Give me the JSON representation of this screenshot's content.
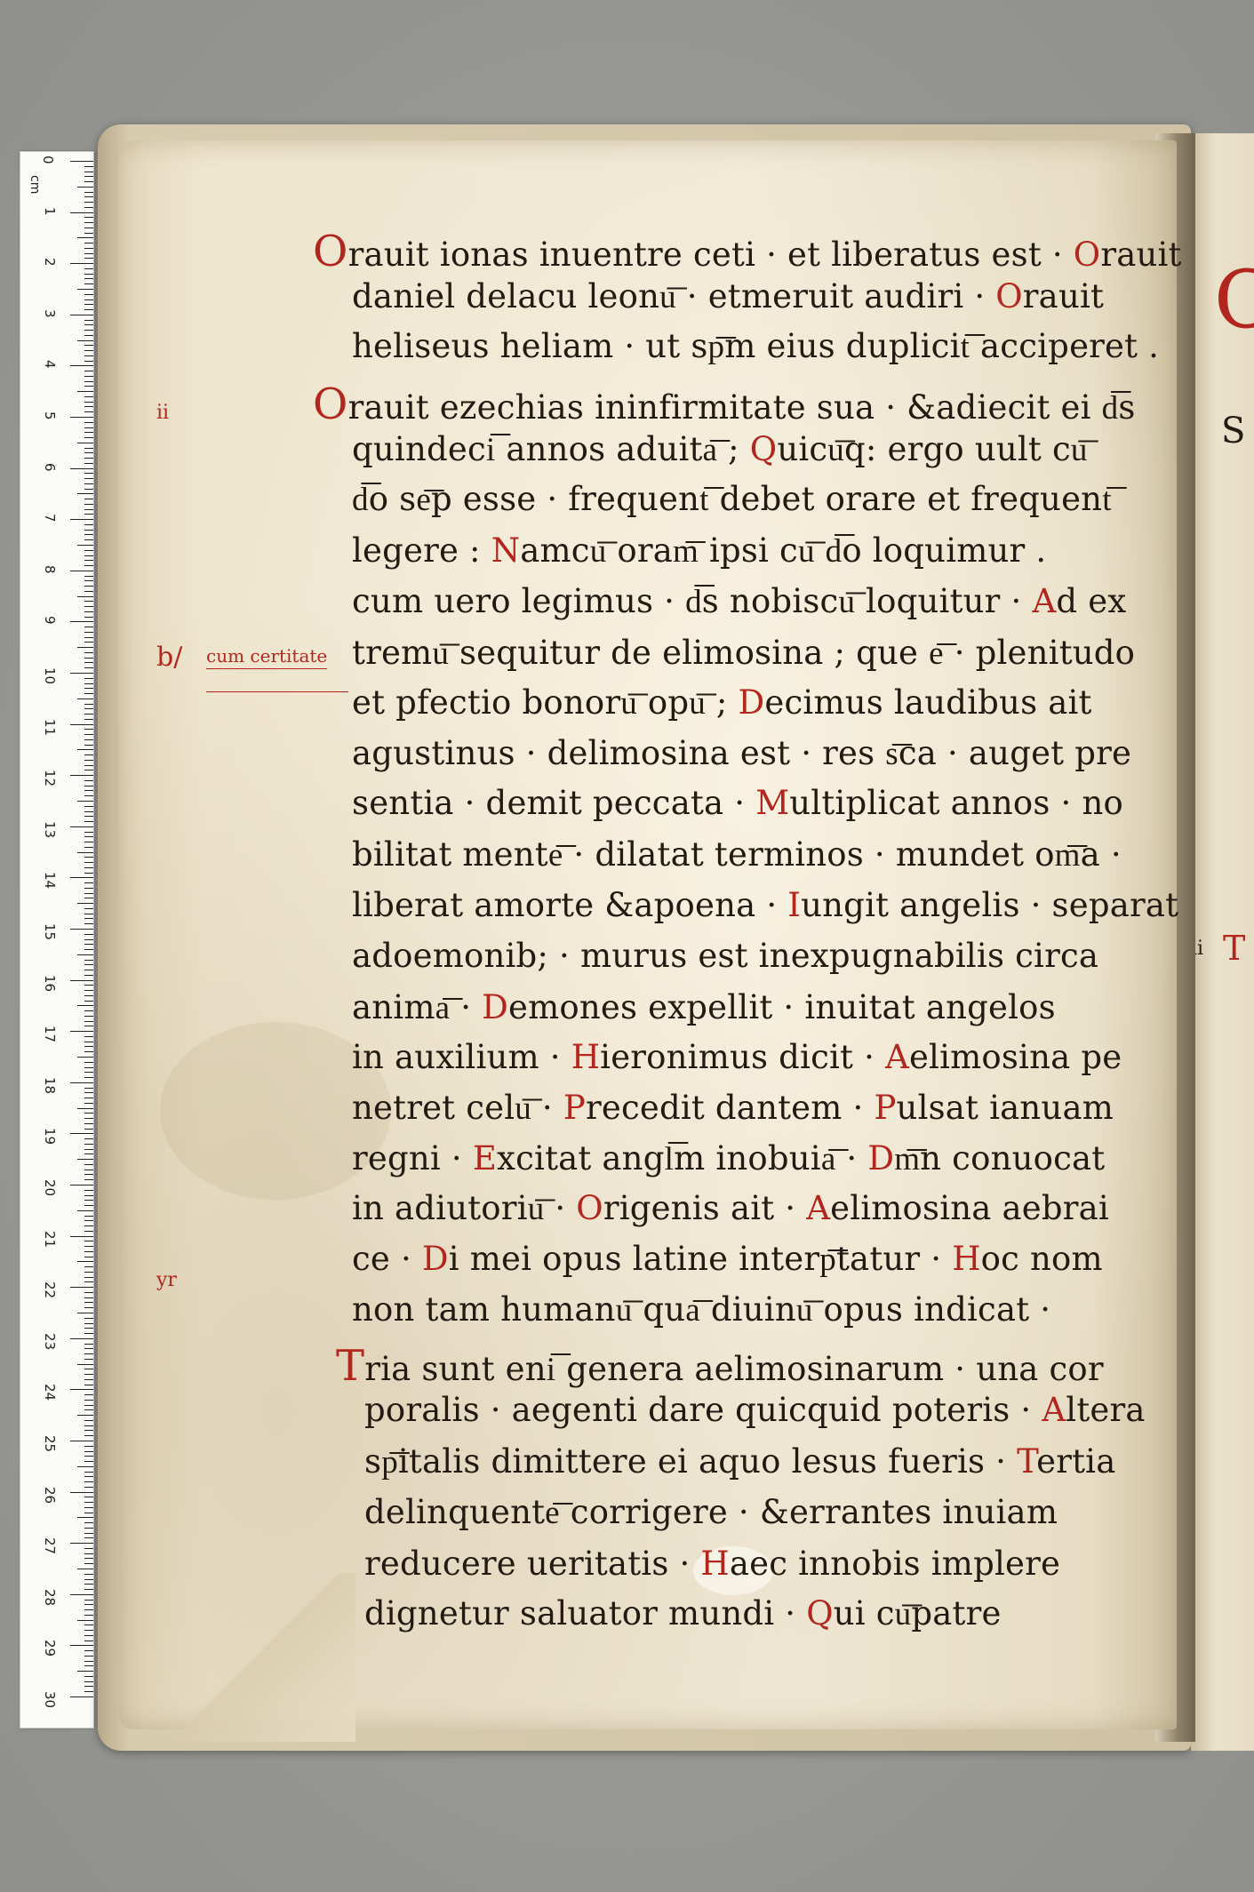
{
  "ruler": {
    "unit": "cm",
    "labels": [
      "0",
      "1",
      "2",
      "3",
      "4",
      "5",
      "6",
      "7",
      "8",
      "9",
      "10",
      "11",
      "12",
      "13",
      "14",
      "15",
      "16",
      "17",
      "18",
      "19",
      "20",
      "21",
      "22",
      "23",
      "24",
      "25",
      "26",
      "27",
      "28",
      "29",
      "30"
    ]
  },
  "margin_notes": {
    "note_1": "ii",
    "note_2": "b/",
    "note_3": "cum certitate",
    "note_4": "yr"
  },
  "next_page_fragments": {
    "f1": "C",
    "f2": "S",
    "f3": "ii",
    "f4": "T"
  },
  "lines": [
    [
      {
        "t": "O",
        "r": true,
        "b": true
      },
      {
        "t": "rauit ionas inuentre ceti · et liberatus est · "
      },
      {
        "t": "O",
        "r": true
      },
      {
        "t": "rauit"
      }
    ],
    [
      {
        "t": "daniel delacu leonu͞ · etmeruit audiri · "
      },
      {
        "t": "O",
        "r": true
      },
      {
        "t": "rauit"
      }
    ],
    [
      {
        "t": "heliseus heliam · ut sp͞m eius duplicit͞ acciperet ."
      }
    ],
    [
      {
        "t": "O",
        "r": true,
        "b": true
      },
      {
        "t": "rauit ezechias ininfirmitate sua · &adiecit ei d͞s"
      }
    ],
    [
      {
        "t": "quindeci͞ annos aduita͞ ; "
      },
      {
        "t": "Q",
        "r": true
      },
      {
        "t": "uicu͞q: ergo uult cu͞"
      }
    ],
    [
      {
        "t": "d͞o se͞p esse · frequent͞ debet orare et frequent͞"
      }
    ],
    [
      {
        "t": "legere : "
      },
      {
        "t": "N",
        "r": true
      },
      {
        "t": "amcu͞ oram͞ ipsi cu͞ d͞o loquimur ."
      }
    ],
    [
      {
        "t": "cum uero legimus · d͞s nobiscu͞ loquitur · "
      },
      {
        "t": "A",
        "r": true
      },
      {
        "t": "d ex"
      }
    ],
    [
      {
        "t": "tremu͞ sequitur de elimosina ; que e͞ · plenitudo"
      }
    ],
    [
      {
        "t": "et pfectio bonoru͞ opu͞ ; "
      },
      {
        "t": "D",
        "r": true
      },
      {
        "t": "ecimus laudibus ait"
      }
    ],
    [
      {
        "t": "agustinus · delimosina est · res s͞ca · auget pre"
      }
    ],
    [
      {
        "t": "sentia · demit peccata · "
      },
      {
        "t": "M",
        "r": true
      },
      {
        "t": "ultiplicat annos · no"
      }
    ],
    [
      {
        "t": "bilitat mente͞ · dilatat terminos · mundet om͞a ·"
      }
    ],
    [
      {
        "t": "liberat amorte &apoena · "
      },
      {
        "t": "I",
        "r": true
      },
      {
        "t": "ungit angelis · separat"
      }
    ],
    [
      {
        "t": "adoemonib; · murus est inexpugnabilis circa"
      }
    ],
    [
      {
        "t": "anima͞ · "
      },
      {
        "t": "D",
        "r": true
      },
      {
        "t": "emones expellit · inuitat angelos"
      }
    ],
    [
      {
        "t": "in auxilium · "
      },
      {
        "t": "H",
        "r": true
      },
      {
        "t": "ieronimus dicit · "
      },
      {
        "t": "A",
        "r": true
      },
      {
        "t": "elimosina pe"
      }
    ],
    [
      {
        "t": "netret celu͞ · "
      },
      {
        "t": "P",
        "r": true
      },
      {
        "t": "recedit dantem · "
      },
      {
        "t": "P",
        "r": true
      },
      {
        "t": "ulsat ianuam"
      }
    ],
    [
      {
        "t": "regni · "
      },
      {
        "t": "E",
        "r": true
      },
      {
        "t": "xcitat angl͞m inobuia͞ · "
      },
      {
        "t": "D",
        "r": true
      },
      {
        "t": "m͞n conuocat"
      }
    ],
    [
      {
        "t": "in adiutoriu͞ · "
      },
      {
        "t": "O",
        "r": true
      },
      {
        "t": "rigenis ait · "
      },
      {
        "t": "A",
        "r": true
      },
      {
        "t": "elimosina aebrai"
      }
    ],
    [
      {
        "t": "ce · "
      },
      {
        "t": "D",
        "r": true
      },
      {
        "t": "i mei opus latine interp͞tatur · "
      },
      {
        "t": "H",
        "r": true
      },
      {
        "t": "oc nom"
      }
    ],
    [
      {
        "t": "non tam humanu͞ qua͞ diuinu͞ opus indicat ·"
      }
    ],
    [
      {
        "t": "T",
        "r": true,
        "b": true
      },
      {
        "t": "ria sunt eni͞ genera aelimosinarum · una cor"
      }
    ],
    [
      {
        "t": "poralis · aegenti dare quicquid poteris · "
      },
      {
        "t": "A",
        "r": true
      },
      {
        "t": "ltera"
      }
    ],
    [
      {
        "t": "sp͞italis dimittere ei aquo lesus fueris · "
      },
      {
        "t": "T",
        "r": true
      },
      {
        "t": "ertia"
      }
    ],
    [
      {
        "t": "delinquente͞ corrigere · &errantes inuiam"
      }
    ],
    [
      {
        "t": "reducere ueritatis · "
      },
      {
        "t": "H",
        "r": true
      },
      {
        "t": "aec innobis implere"
      }
    ],
    [
      {
        "t": "dignetur saluator        mundi · "
      },
      {
        "t": "Q",
        "r": true
      },
      {
        "t": "ui cu͞patre"
      }
    ]
  ]
}
